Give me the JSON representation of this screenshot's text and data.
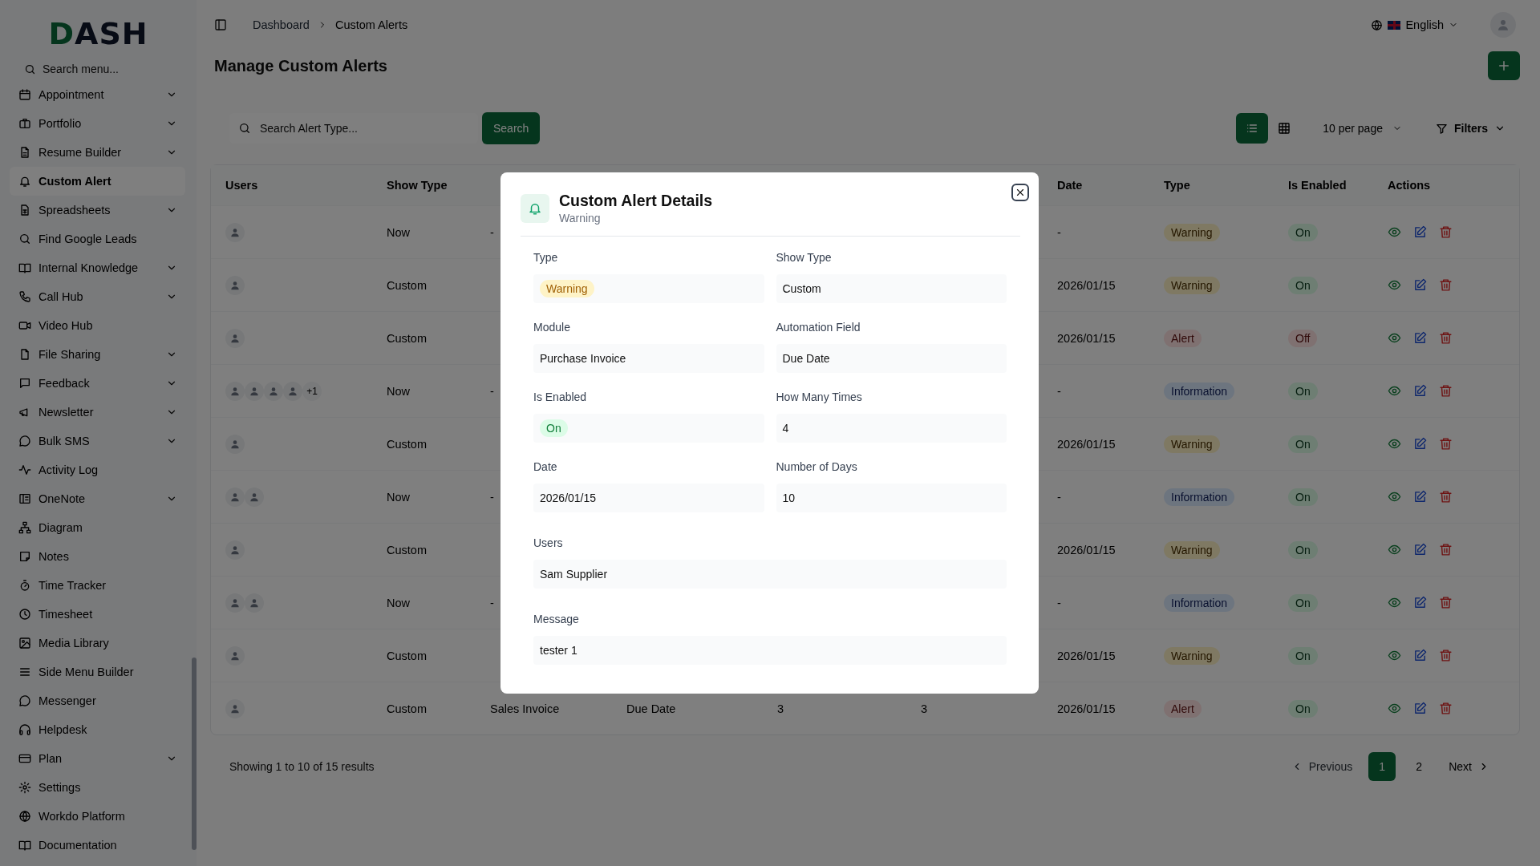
{
  "sidebar": {
    "logo": "DASH",
    "search": {
      "placeholder": "Search menu..."
    },
    "items": [
      {
        "label": "Appointment",
        "expandable": true,
        "selected": false
      },
      {
        "label": "Portfolio",
        "expandable": true,
        "selected": false
      },
      {
        "label": "Resume Builder",
        "expandable": true,
        "selected": false
      },
      {
        "label": "Custom Alert",
        "expandable": false,
        "selected": true
      },
      {
        "label": "Spreadsheets",
        "expandable": true,
        "selected": false
      },
      {
        "label": "Find Google Leads",
        "expandable": false,
        "selected": false
      },
      {
        "label": "Internal Knowledge",
        "expandable": true,
        "selected": false
      },
      {
        "label": "Call Hub",
        "expandable": true,
        "selected": false
      },
      {
        "label": "Video Hub",
        "expandable": false,
        "selected": false
      },
      {
        "label": "File Sharing",
        "expandable": true,
        "selected": false
      },
      {
        "label": "Feedback",
        "expandable": true,
        "selected": false
      },
      {
        "label": "Newsletter",
        "expandable": true,
        "selected": false
      },
      {
        "label": "Bulk SMS",
        "expandable": true,
        "selected": false
      },
      {
        "label": "Activity Log",
        "expandable": false,
        "selected": false
      },
      {
        "label": "OneNote",
        "expandable": true,
        "selected": false
      },
      {
        "label": "Diagram",
        "expandable": false,
        "selected": false
      },
      {
        "label": "Notes",
        "expandable": false,
        "selected": false
      },
      {
        "label": "Time Tracker",
        "expandable": false,
        "selected": false
      },
      {
        "label": "Timesheet",
        "expandable": false,
        "selected": false
      },
      {
        "label": "Media Library",
        "expandable": false,
        "selected": false
      },
      {
        "label": "Side Menu Builder",
        "expandable": false,
        "selected": false
      },
      {
        "label": "Messenger",
        "expandable": false,
        "selected": false
      },
      {
        "label": "Helpdesk",
        "expandable": false,
        "selected": false
      },
      {
        "label": "Plan",
        "expandable": true,
        "selected": false
      },
      {
        "label": "Settings",
        "expandable": false,
        "selected": false
      },
      {
        "label": "Workdo Platform",
        "expandable": false,
        "selected": false
      },
      {
        "label": "Documentation",
        "expandable": false,
        "selected": false
      }
    ]
  },
  "topbar": {
    "breadcrumb": [
      "Dashboard",
      "Custom Alerts"
    ],
    "language": "English"
  },
  "page": {
    "title": "Manage Custom Alerts"
  },
  "toolbar": {
    "search": {
      "placeholder": "Search Alert Type..."
    },
    "search_button": "Search",
    "views": [
      {
        "kind": "list",
        "selected": true
      },
      {
        "kind": "grid",
        "selected": false
      }
    ],
    "per_page": "10 per page",
    "filters": "Filters"
  },
  "table": {
    "columns": {
      "users": "Users",
      "show_type": "Show Type",
      "date": "Date",
      "type": "Type",
      "is_enabled": "Is Enabled",
      "actions": "Actions"
    },
    "rows": [
      {
        "avatars": [
          {
            "kind": "avatar"
          }
        ],
        "show_type": "Now",
        "column_3": "-",
        "date": "-",
        "type": {
          "label": "Warning",
          "kind": "warning"
        },
        "enabled": {
          "label": "On",
          "on": true
        }
      },
      {
        "avatars": [
          {
            "kind": "avatar"
          }
        ],
        "show_type": "Custom",
        "date": "2026/01/15",
        "type": {
          "label": "Warning",
          "kind": "warning"
        },
        "enabled": {
          "label": "On",
          "on": true
        }
      },
      {
        "avatars": [
          {
            "kind": "avatar"
          }
        ],
        "show_type": "Custom",
        "date": "2026/01/15",
        "type": {
          "label": "Alert",
          "kind": "alert"
        },
        "enabled": {
          "label": "Off",
          "on": false
        }
      },
      {
        "avatars": [
          {
            "kind": "avatar"
          },
          {
            "kind": "avatar"
          },
          {
            "kind": "avatar"
          },
          {
            "kind": "avatar"
          }
        ],
        "more": "+1",
        "show_type": "Now",
        "column_3": "-",
        "date": "-",
        "type": {
          "label": "Information",
          "kind": "information"
        },
        "enabled": {
          "label": "On",
          "on": true
        }
      },
      {
        "avatars": [
          {
            "kind": "avatar"
          }
        ],
        "show_type": "Custom",
        "date": "2026/01/15",
        "type": {
          "label": "Warning",
          "kind": "warning"
        },
        "enabled": {
          "label": "On",
          "on": true
        }
      },
      {
        "avatars": [
          {
            "kind": "avatar"
          },
          {
            "kind": "avatar"
          }
        ],
        "show_type": "Now",
        "column_3": "-",
        "date": "-",
        "type": {
          "label": "Information",
          "kind": "information"
        },
        "enabled": {
          "label": "On",
          "on": true
        }
      },
      {
        "avatars": [
          {
            "kind": "avatar"
          }
        ],
        "show_type": "Custom",
        "date": "2026/01/15",
        "type": {
          "label": "Warning",
          "kind": "warning"
        },
        "enabled": {
          "label": "On",
          "on": true
        }
      },
      {
        "avatars": [
          {
            "kind": "avatar"
          },
          {
            "kind": "avatar"
          }
        ],
        "show_type": "Now",
        "column_3": "-",
        "date": "-",
        "type": {
          "label": "Information",
          "kind": "information"
        },
        "enabled": {
          "label": "On",
          "on": true
        }
      },
      {
        "avatars": [
          {
            "kind": "avatar"
          }
        ],
        "show_type": "Custom",
        "date": "2026/01/15",
        "type": {
          "label": "Warning",
          "kind": "warning"
        },
        "enabled": {
          "label": "On",
          "on": true
        }
      },
      {
        "avatars": [
          {
            "kind": "avatar"
          }
        ],
        "show_type": "Custom",
        "column_3": "Sales Invoice",
        "column_4": "Due Date",
        "column_5": "3",
        "column_6": "3",
        "date": "2026/01/15",
        "type": {
          "label": "Alert",
          "kind": "alert"
        },
        "enabled": {
          "label": "On",
          "on": true
        }
      }
    ]
  },
  "pagination": {
    "summary": "Showing 1 to 10 of 15 results",
    "previous": {
      "label": "Previous",
      "disabled": true
    },
    "pages": [
      {
        "label": "1",
        "selected": true
      },
      {
        "label": "2",
        "selected": false
      }
    ],
    "next": {
      "label": "Next",
      "disabled": false
    }
  },
  "modal": {
    "title": "Custom Alert Details",
    "subtitle": "Warning",
    "fields": [
      {
        "label": "Type",
        "value": "Warning",
        "kind": "warning",
        "wide": false
      },
      {
        "label": "Show Type",
        "value": "Custom",
        "kind": "text",
        "wide": false
      },
      {
        "label": "Module",
        "value": "Purchase Invoice",
        "kind": "text",
        "wide": false
      },
      {
        "label": "Automation Field",
        "value": "Due Date",
        "kind": "text",
        "wide": false
      },
      {
        "label": "Is Enabled",
        "value": "On",
        "kind": "on",
        "wide": false
      },
      {
        "label": "How Many Times",
        "value": "4",
        "kind": "text",
        "wide": false
      },
      {
        "label": "Date",
        "value": "2026/01/15",
        "kind": "text",
        "wide": false
      },
      {
        "label": "Number of Days",
        "value": "10",
        "kind": "text",
        "wide": false
      },
      {
        "label": "Users",
        "value": "Sam Supplier",
        "kind": "text",
        "wide": true
      },
      {
        "label": "Message",
        "value": "tester 1",
        "kind": "text",
        "wide": true
      }
    ]
  }
}
